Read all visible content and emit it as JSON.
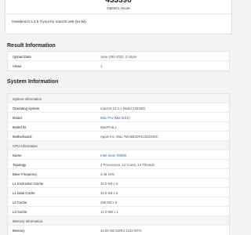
{
  "score": {
    "value": "433396",
    "label": "OpenCL Score",
    "version": "Geekbench 5.4.5 Tryout for macOS x86 (64-bit)"
  },
  "result_info": {
    "title": "Result Information",
    "rows": [
      {
        "key": "Upload Date",
        "value": "June 10th 2022, 2:44pm"
      },
      {
        "key": "Views",
        "value": "1"
      }
    ]
  },
  "system_info": {
    "title": "System Information",
    "groups": [
      {
        "header": "System Information",
        "rows": [
          {
            "key": "Operating System",
            "value": "macOS 12.3.1 (Build 21E258)"
          },
          {
            "key": "Model",
            "value": "Mac Pro (Mid 2010)"
          },
          {
            "key": "Model ID",
            "value": "MacPro5,1"
          },
          {
            "key": "Motherboard",
            "value": "Apple Inc. Mac-7BA5B2DFE22DDD8C"
          }
        ]
      },
      {
        "header": "CPU Information",
        "rows": [
          {
            "key": "Name",
            "value": "Intel Xeon X5690"
          },
          {
            "key": "Topology",
            "value": "2 Processors, 12 Cores, 24 Threads"
          },
          {
            "key": "Base Frequency",
            "value": "3.46 GHz"
          },
          {
            "key": "L1 Instruction Cache",
            "value": "32.0 KB x 6"
          },
          {
            "key": "L1 Data Cache",
            "value": "32.0 KB x 6"
          },
          {
            "key": "L2 Cache",
            "value": "256 KB x 6"
          },
          {
            "key": "L3 Cache",
            "value": "12.0 MB x 1"
          }
        ]
      },
      {
        "header": "Memory Information",
        "rows": [
          {
            "key": "Memory",
            "value": "24.00 GB DDR3 1333 MT/s"
          }
        ]
      }
    ]
  },
  "colors": {
    "background": "#f4f4f4",
    "card": "#ffffff",
    "link": "#2f68b5",
    "header_row": "#f6f6f6"
  }
}
